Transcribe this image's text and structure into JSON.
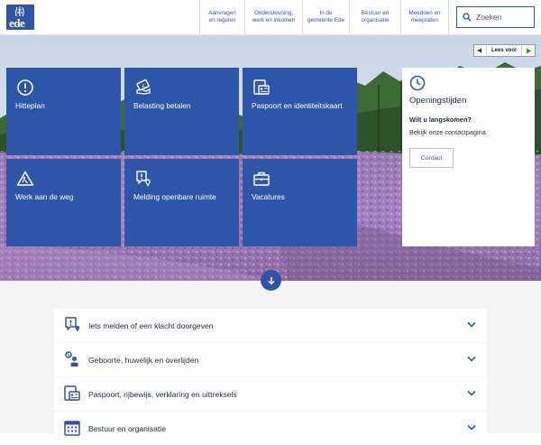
{
  "header": {
    "logo_text": "ede",
    "nav": [
      {
        "label": "Aanvragen\nen regelen"
      },
      {
        "label": "Ondersteuning,\nwerk en inkomen"
      },
      {
        "label": "In de\ngemeente Ede"
      },
      {
        "label": "Bestuur en\norganisatie"
      },
      {
        "label": "Meedoen en\nmeepraten"
      }
    ],
    "search": {
      "placeholder": "Zoeken",
      "value": ""
    }
  },
  "hero": {
    "tts_label": "Lees voor",
    "tiles": [
      {
        "label": "Hitteplan",
        "icon": "exclamation-circle-icon"
      },
      {
        "label": "Belasting betalen",
        "icon": "tax-payment-icon"
      },
      {
        "label": "Paspoort en identiteitskaart",
        "icon": "passport-icon"
      },
      {
        "label": "Werk aan de weg",
        "icon": "road-work-icon"
      },
      {
        "label": "Melding openbare ruimte",
        "icon": "report-location-icon"
      },
      {
        "label": "Vacatures",
        "icon": "briefcase-icon"
      }
    ],
    "opening_hours": {
      "title": "Openingstijden",
      "question": "Wilt u langskomen?",
      "text": "Bekijk onze contactpagina",
      "button": "Contact"
    }
  },
  "accordion": [
    {
      "label": "Iets melden of een klacht doorgeven",
      "icon": "report-icon"
    },
    {
      "label": "Geboorte, huwelijk en overlijden",
      "icon": "life-events-icon"
    },
    {
      "label": "Paspoort, rijbewijs, verklaring en uittreksels",
      "icon": "documents-icon"
    },
    {
      "label": "Bestuur en organisatie",
      "icon": "calendar-icon"
    }
  ],
  "colors": {
    "brand": "#2f55a4",
    "tile": "#2d55a8",
    "heather": "#a77cc0",
    "forest": "#2f5a2b"
  }
}
